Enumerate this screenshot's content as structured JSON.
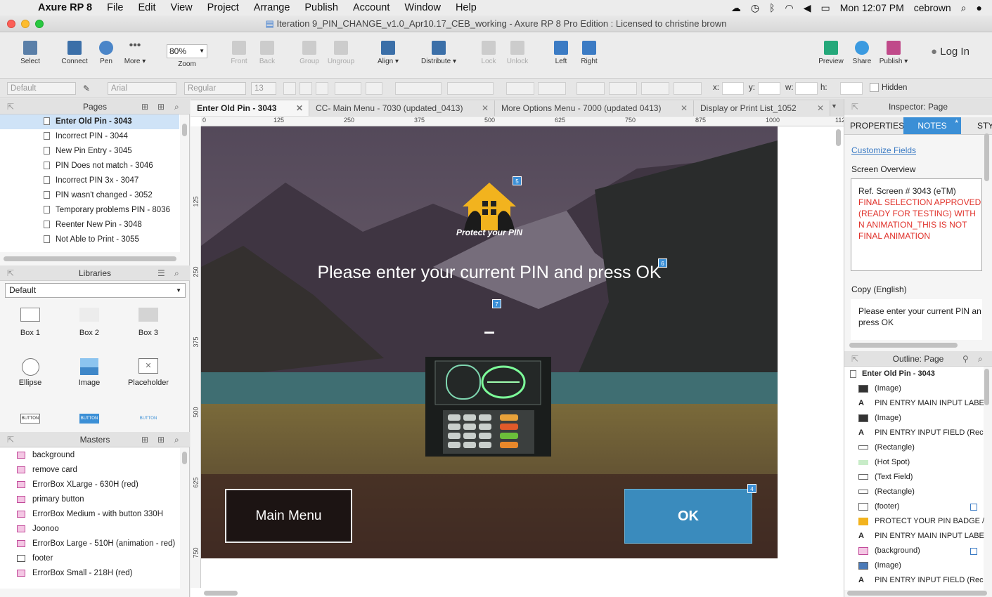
{
  "menubar": {
    "app": "Axure RP 8",
    "items": [
      "File",
      "Edit",
      "View",
      "Project",
      "Arrange",
      "Publish",
      "Account",
      "Window",
      "Help"
    ],
    "clock": "Mon 12:07 PM",
    "user": "cebrown"
  },
  "window": {
    "title": "Iteration 9_PIN_CHANGE_v1.0_Apr10.17_CEB_working - Axure RP 8 Pro Edition : Licensed to christine brown"
  },
  "toolbar": {
    "select": "Select",
    "connect": "Connect",
    "pen": "Pen",
    "more": "More ▾",
    "zoom_value": "80%",
    "zoom": "Zoom",
    "front": "Front",
    "back": "Back",
    "group": "Group",
    "ungroup": "Ungroup",
    "align": "Align ▾",
    "distribute": "Distribute ▾",
    "lock": "Lock",
    "unlock": "Unlock",
    "left": "Left",
    "right": "Right",
    "preview": "Preview",
    "share": "Share",
    "publish": "Publish ▾",
    "login": "Log In"
  },
  "format": {
    "style": "Default",
    "font": "Arial",
    "weight": "Regular",
    "size": "13",
    "x": "x:",
    "y": "y:",
    "w": "w:",
    "h": "h:",
    "hidden": "Hidden"
  },
  "pages": {
    "title": "Pages",
    "items": [
      "Enter Old Pin - 3043",
      "Incorrect PIN  - 3044",
      "New Pin Entry - 3045",
      "PIN Does not match - 3046",
      "Incorrect PIN 3x - 3047",
      "PIN wasn't changed - 3052",
      "Temporary problems PIN - 8036",
      "Reenter New Pin - 3048",
      "Not Able to Print - 3055"
    ]
  },
  "libraries": {
    "title": "Libraries",
    "selected": "Default",
    "items": [
      "Box 1",
      "Box 2",
      "Box 3",
      "Ellipse",
      "Image",
      "Placeholder",
      "BUTTON",
      "BUTTON",
      "BUTTON"
    ]
  },
  "masters": {
    "title": "Masters",
    "items": [
      "background",
      "remove card",
      "ErrorBox XLarge - 630H (red)",
      "primary button",
      "ErrorBox Medium - with button 330H",
      "Joonoo",
      "ErrorBox Large - 510H (animation - red)",
      "footer",
      "ErrorBox Small - 218H (red)"
    ]
  },
  "tabs": [
    "Enter Old Pin - 3043",
    "CC- Main Menu - 7030 (updated_0413)",
    "More Options Menu - 7000 (updated 0413)",
    "Display or Print List_1052"
  ],
  "ruler": {
    "h": [
      "0",
      "125",
      "250",
      "375",
      "500",
      "625",
      "750",
      "875",
      "1000",
      "112"
    ],
    "v": [
      "125",
      "250",
      "375",
      "500",
      "625",
      "750"
    ]
  },
  "screen": {
    "logo_text": "Protect your PIN",
    "prompt": "Please enter your current PIN and press OK",
    "pin_mask": "–",
    "main_menu": "Main Menu",
    "ok": "OK",
    "badges": [
      "5",
      "6",
      "7",
      "4"
    ]
  },
  "inspector": {
    "title": "Inspector: Page",
    "tabs": [
      "PROPERTIES",
      "NOTES",
      "STY"
    ],
    "customize": "Customize Fields",
    "overview_label": "Screen Overview",
    "ref": "Ref. Screen # 3043 (eTM)",
    "final_note": "FINAL SELECTION APPROVED (READY FOR TESTING) WITH N ANIMATION_THIS IS NOT FINAL ANIMATION",
    "copy_label": "Copy (English)",
    "copy_text": "Please enter your current PIN an press OK"
  },
  "outline": {
    "title": "Outline: Page",
    "root": "Enter Old Pin - 3043",
    "items": [
      "(Image)",
      "PIN ENTRY MAIN INPUT LABE",
      "(Image)",
      "PIN  ENTRY INPUT FIELD  (Rec",
      "(Rectangle)",
      "(Hot Spot)",
      "(Text Field)",
      "(Rectangle)",
      "(footer)",
      "PROTECT YOUR PIN BADGE /",
      "PIN ENTRY MAIN INPUT LABE",
      "(background)",
      "(Image)",
      "PIN  ENTRY INPUT FIELD  (Rec"
    ]
  },
  "colors": {
    "accent": "#3b8fd6",
    "note_red": "#e0312a",
    "ok_btn": "#3a8bbd"
  }
}
